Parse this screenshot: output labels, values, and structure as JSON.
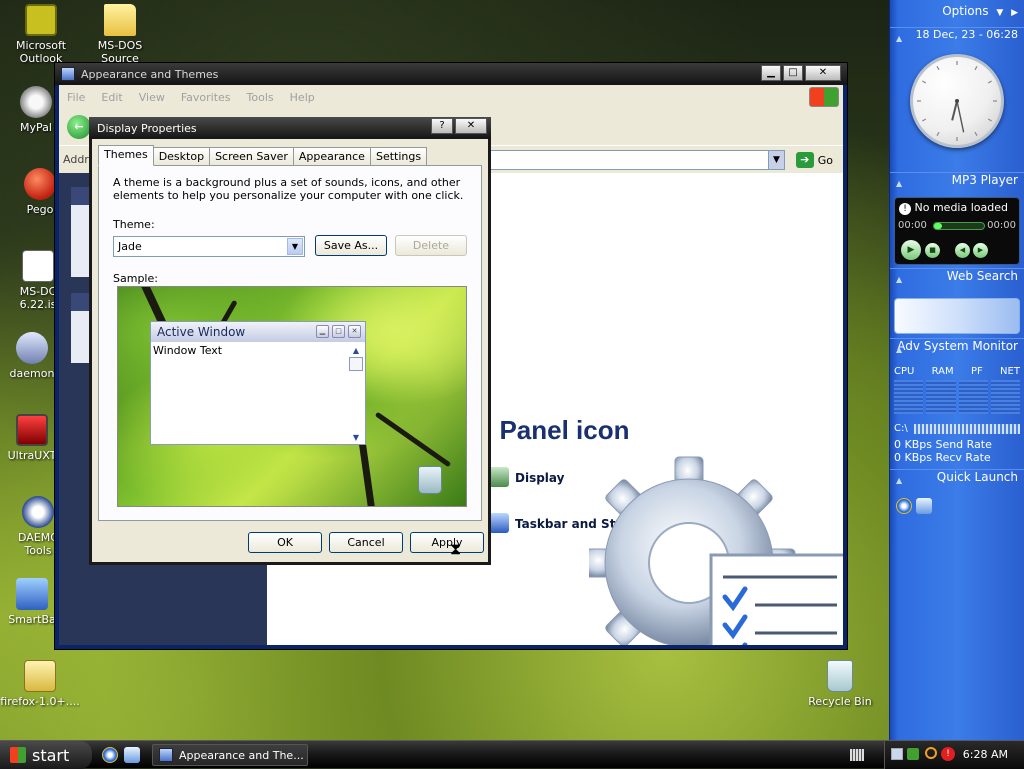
{
  "desktop_icons": [
    {
      "label": "Microsoft Outlook",
      "label2": "Outlook",
      "label1": "Microsoft"
    },
    {
      "label1": "MS-DOS",
      "label2": "Source"
    },
    {
      "label1": "MyPal"
    },
    {
      "label1": "Pego"
    },
    {
      "label1": "MS-DC",
      "label2": "6.22.is"
    },
    {
      "label1": "daemon"
    },
    {
      "label1": "UltraUXT"
    },
    {
      "label1": "DAEMC",
      "label2": "Tools"
    },
    {
      "label1": "SmartBa"
    },
    {
      "label1": "firefox-1.0+...."
    },
    {
      "label1": "Recycle Bin"
    }
  ],
  "explorer": {
    "title": "Appearance and Themes",
    "menu": [
      "File",
      "Edit",
      "View",
      "Favorites",
      "Tools",
      "Help"
    ],
    "address_label": "Addre",
    "go_label": "Go",
    "heading": "rol Panel icon",
    "links": [
      "Display",
      "Taskbar and Start Menu"
    ]
  },
  "dialog": {
    "title": "Display Properties",
    "help_btn": "?",
    "close_btn": "✕",
    "tabs": [
      "Themes",
      "Desktop",
      "Screen Saver",
      "Appearance",
      "Settings"
    ],
    "description": "A theme is a background plus a set of sounds, icons, and other elements to help you personalize your computer with one click.",
    "theme_label": "Theme:",
    "theme_value": "Jade",
    "save_as": "Save As...",
    "delete": "Delete",
    "sample_label": "Sample:",
    "sample_window_title": "Active Window",
    "sample_window_text": "Window Text",
    "ok": "OK",
    "cancel": "Cancel",
    "apply": "Apply"
  },
  "sidebar": {
    "options": "Options",
    "date": "18 Dec, 23 - 06:28",
    "clock": {
      "hour": 6,
      "minute": 28
    },
    "mp3_title": "MP3 Player",
    "mp3_status": "No media loaded",
    "mp3_time_left": "00:00",
    "mp3_time_right": "00:00",
    "web_search": "Web Search",
    "sysmon_title": "Adv System Monitor",
    "sysmon_cols": [
      "CPU",
      "RAM",
      "PF",
      "NET"
    ],
    "drive": "C:\\",
    "send_rate": "0 KBps Send Rate",
    "recv_rate": "0 KBps Recv Rate",
    "quick_launch": "Quick Launch"
  },
  "taskbar": {
    "start": "start",
    "task": "Appearance and The...",
    "time": "6:28 AM"
  }
}
